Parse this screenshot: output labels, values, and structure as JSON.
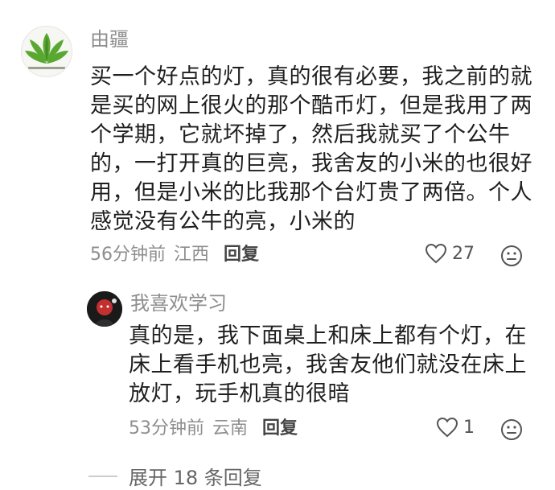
{
  "main_comment": {
    "username": "由疆",
    "text": "买一个好点的灯，真的很有必要，我之前的就\n是买的网上很火的那个酷币灯，但是我用了两\n个学期，它就坏掉了，然后我就买了个公牛\n的，一打开真的巨亮，我舍友的小米的也很好\n用，但是小米的比我那个台灯贵了两倍。个人\n感觉没有公牛的亮，小米的",
    "time": "56分钟前",
    "location": "江西",
    "reply_label": "回复",
    "likes": "27"
  },
  "reply_comment": {
    "username": "我喜欢学习",
    "text": "真的是，我下面桌上和床上都有个灯，在\n床上看手机也亮，我舍友他们就没在床上\n放灯，玩手机真的很暗",
    "time": "53分钟前",
    "location": "云南",
    "reply_label": "回复",
    "likes": "1"
  },
  "expand_replies": "展开 18 条回复",
  "colors": {
    "meta_gray": "#8e8e8e",
    "text": "#1f1f1f",
    "avatar_plant": "#5aa832"
  },
  "icons": {
    "like": "heart-outline-icon",
    "emoji": "emoji-face-icon"
  }
}
